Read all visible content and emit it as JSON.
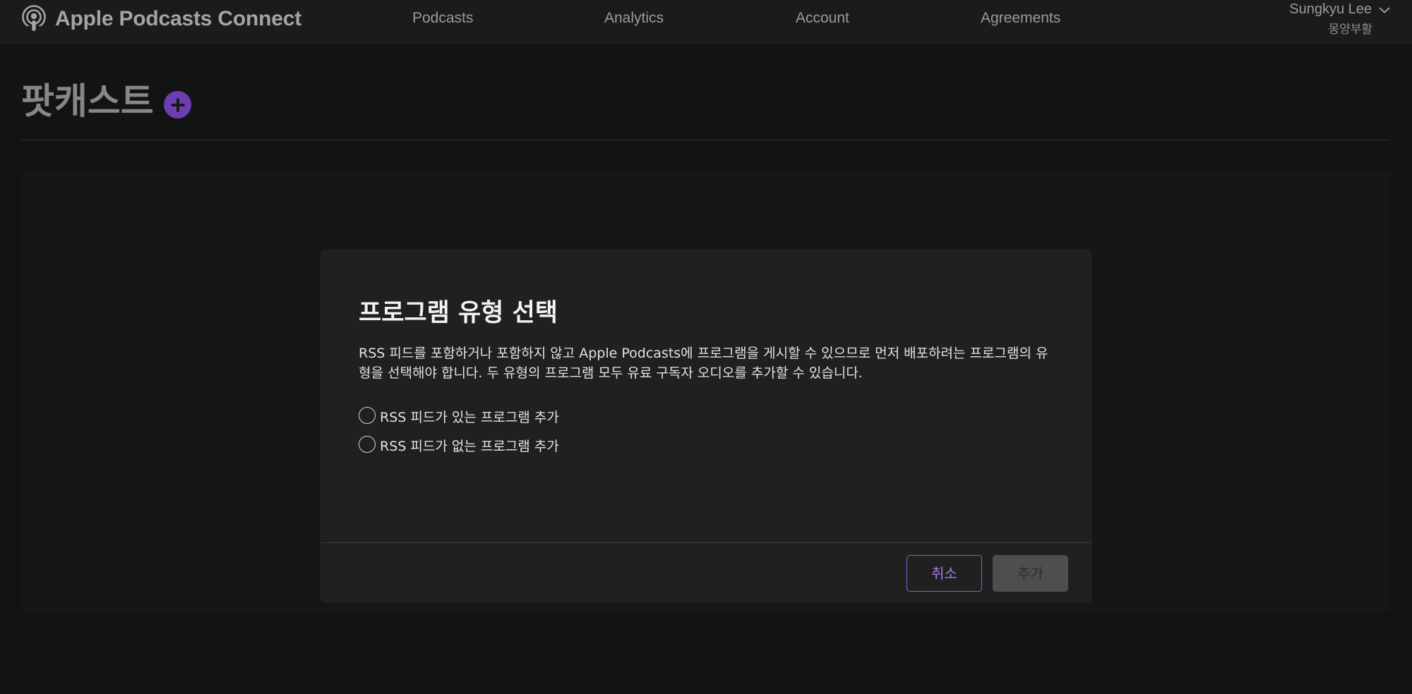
{
  "app": {
    "brand_name": "Apple Podcasts Connect",
    "brand_icon": "podcasts-icon"
  },
  "nav": {
    "items": [
      {
        "label": "Podcasts"
      },
      {
        "label": "Analytics"
      },
      {
        "label": "Account"
      },
      {
        "label": "Agreements"
      }
    ]
  },
  "user": {
    "name": "Sungkyu Lee",
    "subtitle": "몽양부활",
    "menu_icon": "chevron-down-icon"
  },
  "page": {
    "title": "팟캐스트",
    "add_icon": "plus-circle-icon"
  },
  "modal": {
    "title": "프로그램 유형 선택",
    "description_line1": "RSS 피드를 포함하거나 포함하지 않고 Apple Podcasts에 프로그램을 게시할 수 있으므로 먼저 배포하려는 프로그램의 유",
    "description_line2": "형을 선택해야 합니다. 두 유형의 프로그램 모두 유료 구독자 오디오를 추가할 수 있습니다.",
    "options": [
      {
        "label": "RSS 피드가 있는 프로그램 추가",
        "selected": false
      },
      {
        "label": "RSS 피드가 없는 프로그램 추가",
        "selected": false
      }
    ],
    "cancel_label": "취소",
    "add_label": "추가"
  },
  "colors": {
    "background": "#131313",
    "accent": "#6b3fb2",
    "cancel_border": "#8c5bd6",
    "disabled_button": "#4e4e4e"
  }
}
